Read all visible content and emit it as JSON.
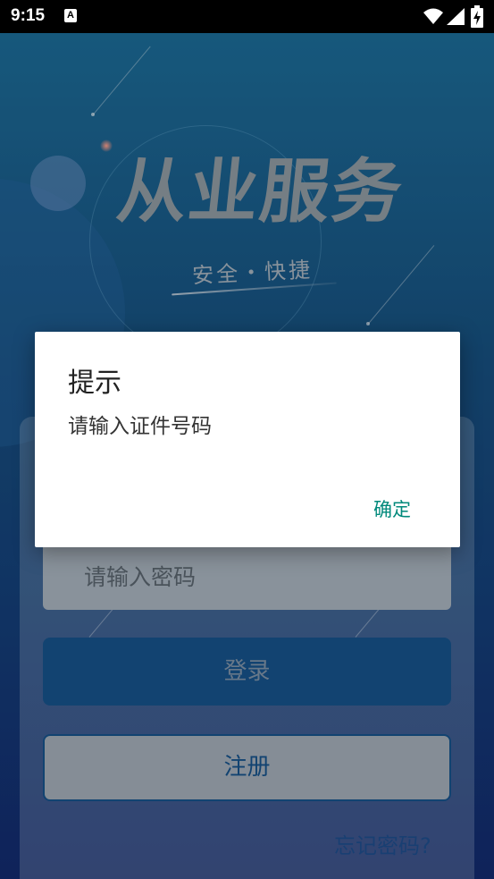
{
  "status_bar": {
    "time": "9:15",
    "notification_icon": "A",
    "icons": [
      "wifi-icon",
      "signal-icon",
      "battery-charging-icon"
    ]
  },
  "branding": {
    "title": "从业服务",
    "slogan": "安全・快捷"
  },
  "login_form": {
    "password_placeholder": "请输入密码",
    "login_label": "登录",
    "register_label": "注册",
    "forgot_password_label": "忘记密码?"
  },
  "dialog": {
    "title": "提示",
    "message": "请输入证件号码",
    "confirm_label": "确定"
  },
  "colors": {
    "accent_button": "#16528a",
    "dialog_action": "#00897b"
  }
}
